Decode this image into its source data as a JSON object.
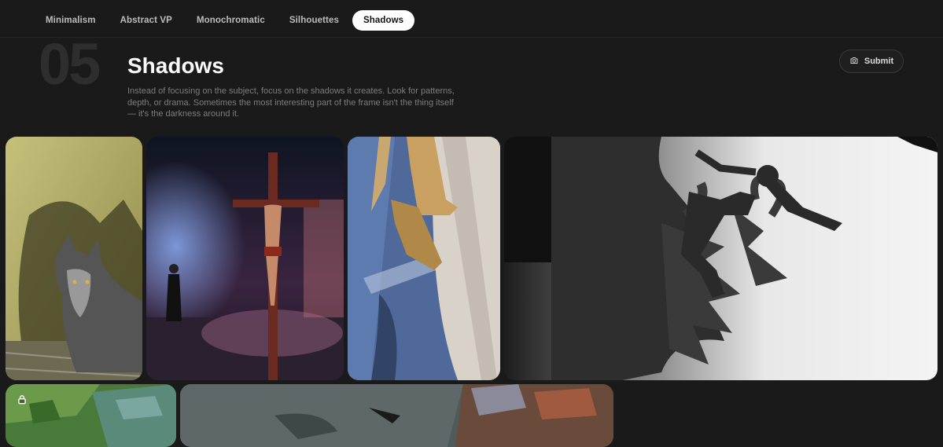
{
  "tabs": [
    {
      "label": "Minimalism",
      "active": false
    },
    {
      "label": "Abstract VP",
      "active": false
    },
    {
      "label": "Monochromatic",
      "active": false
    },
    {
      "label": "Silhouettes",
      "active": false
    },
    {
      "label": "Shadows",
      "active": true
    }
  ],
  "challenge": {
    "number": "05",
    "title": "Shadows",
    "description": "Instead of focusing on the subject, focus on the shadows it creates. Look for patterns, depth, or drama. Sometimes the most interesting part of the frame isn't the thing itself — it's the darkness around it."
  },
  "submit": {
    "label": "Submit",
    "icon": "camera-icon"
  },
  "photos": [
    {
      "subject": "wolf-shadow"
    },
    {
      "subject": "crucifixion-stage"
    },
    {
      "subject": "golden-sandals"
    },
    {
      "subject": "jumping-figure-shadow"
    },
    {
      "subject": "grass-shore",
      "locked": true
    },
    {
      "subject": "cluttered-desk"
    }
  ],
  "colors": {
    "background": "#1a1a1a",
    "active_tab": "#ffffff",
    "muted_text": "#7d7d7d"
  }
}
